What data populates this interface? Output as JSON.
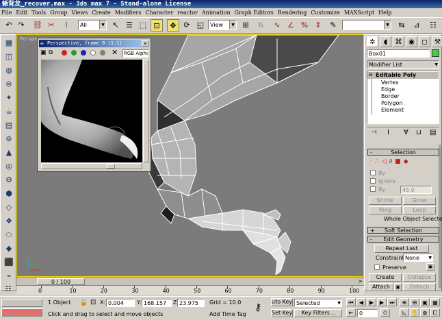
{
  "title": "蜥背龙_recover.max - 3ds max 7   - Stand-alone License",
  "menu": [
    "File",
    "Edit",
    "Tools",
    "Group",
    "Views",
    "Create",
    "Modifiers",
    "Character",
    "reactor",
    "Animation",
    "Graph Editors",
    "Rendering",
    "Customize",
    "MAXScript",
    "Help"
  ],
  "toolbar": {
    "selection_filter": "All",
    "ref_coord": "View",
    "named_selection": ""
  },
  "viewport": {
    "label": "Perspective"
  },
  "frame_window": {
    "title": "Perspective, frame 0 (1:1)",
    "channel": "RGB Alpha"
  },
  "command_panel": {
    "object_name": "Box01",
    "modifier_list": "Modifier List",
    "stack": {
      "root": "Editable Poly",
      "items": [
        "Vertex",
        "Edge",
        "Border",
        "Polygon",
        "Element"
      ]
    },
    "selection": {
      "title": "Selection",
      "by_vertex": "By",
      "ignore_backfacing": "Ignore",
      "by_angle": "By",
      "angle_value": "45.0",
      "shrink": "Shrink",
      "grow": "Grow",
      "ring": "Ring",
      "loop": "Loop",
      "status": "Whole Object Selected"
    },
    "soft_selection": {
      "title": "Soft Selection"
    },
    "edit_geometry": {
      "title": "Edit Geometry",
      "repeat_last": "Repeat Last",
      "constraints_label": "Constraints:",
      "constraints_value": "None",
      "preserve": "Preserve",
      "create": "Create",
      "collapse": "Collapse",
      "attach": "Attach",
      "detach": "Detach"
    }
  },
  "time": {
    "slider": "0 / 100",
    "ticks": [
      "0",
      "10",
      "20",
      "30",
      "40",
      "50",
      "60",
      "70",
      "80",
      "90",
      "100"
    ]
  },
  "status": {
    "selection": "1 Object",
    "x": "0.004",
    "y": "168.157",
    "z": "23.975",
    "grid": "Grid = 10.0",
    "prompt": "Click and drag to select and move objects",
    "add_time_tag": "Add Time Tag",
    "auto_key": "uto Key",
    "set_key": "Set Key",
    "key_mode": "Selected",
    "key_filters": "Key Filters...",
    "frame": "0"
  },
  "colors": {
    "viewport_bg": "#7b7b7b",
    "active_border": "#e8d000",
    "title_gradient": "#0a246a",
    "object_color": "#44cc44"
  }
}
